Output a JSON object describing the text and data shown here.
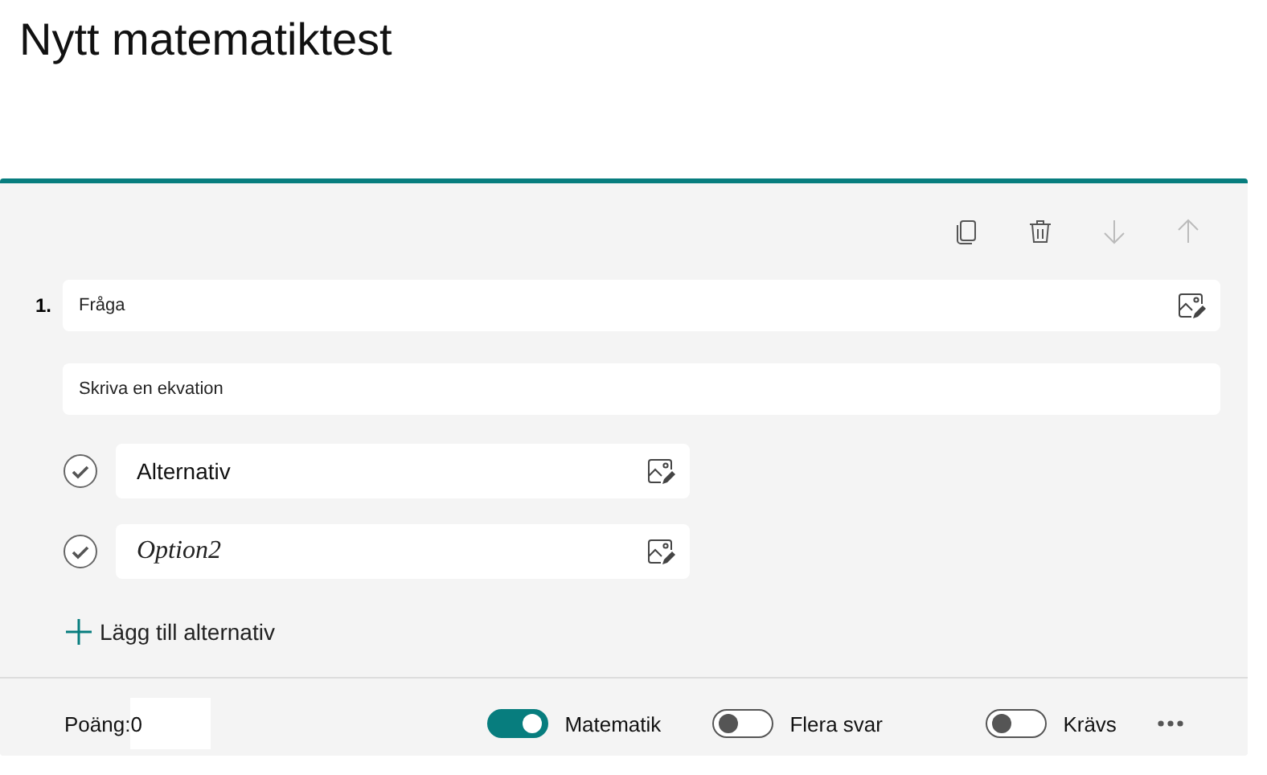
{
  "title": "Nytt matematiktest",
  "toolbar": [
    {
      "kind": "copy",
      "disabled": false
    },
    {
      "kind": "delete",
      "disabled": false
    },
    {
      "kind": "down",
      "disabled": true
    },
    {
      "kind": "up",
      "disabled": true
    }
  ],
  "question": {
    "number": "1.",
    "placeholder": "Fråga",
    "subtitle_placeholder": "Skriva en ekvation"
  },
  "options": [
    {
      "kind": "text",
      "value": "Alternativ",
      "correct": false
    },
    {
      "kind": "math",
      "value": "Option2",
      "correct": false
    }
  ],
  "add_option": "Lägg till alternativ",
  "footer": {
    "points_label": "Poäng:",
    "points_value": "0",
    "toggles": [
      {
        "label": "Matematik",
        "on": true
      },
      {
        "label": "Flera svar",
        "on": false
      },
      {
        "label": "Krävs",
        "on": false
      }
    ]
  }
}
